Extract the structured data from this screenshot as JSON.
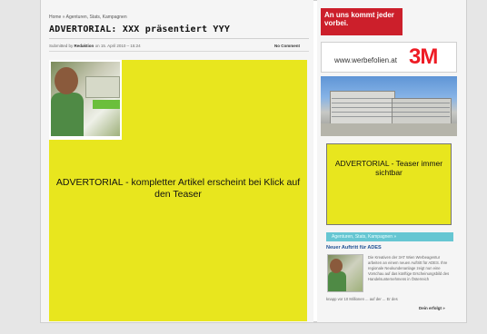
{
  "breadcrumb": "Home » Agenturen, Stats, Kampagnen",
  "article": {
    "title": "ADVERTORIAL: XXX präsentiert YYY",
    "meta_prefix": "Submitted by",
    "meta_author": "Redaktion",
    "meta_date": "on 15. April 2010 – 15:24",
    "comments": "No Comment",
    "main_text": "ADVERTORIAL - kompletter Artikel erscheint bei Klick auf den Teaser"
  },
  "sidebar": {
    "banner_red": "An uns kommt jeder vorbei.",
    "banner_3m_url": "www.werbefolien.at",
    "banner_3m_logo": "3M",
    "teaser_text": "ADVERTORIAL - Teaser immer sichtbar",
    "section_title": "Agenturen, Stats, Kampagnen »",
    "headline": "Neuer Auftritt für ADES",
    "body_text": "Die Kreativen der 3AT Wien Werbeagentur arbeiten an einem neuen Auftritt für ADES. Ihre regionale Neukundenanlage zeigt nun eine Vorschau auf das künftige Erscheinungsbild des Handelsunternehmens in Österreich",
    "body_tail": "knapp vor 10 Millionen ... auf der ... Er des",
    "more": "Dein erfolgt »"
  },
  "colors": {
    "yellow": "#e8e61e",
    "red": "#cc1f2b",
    "cyan": "#66c6d2",
    "brand_3m": "#ee1c25"
  }
}
